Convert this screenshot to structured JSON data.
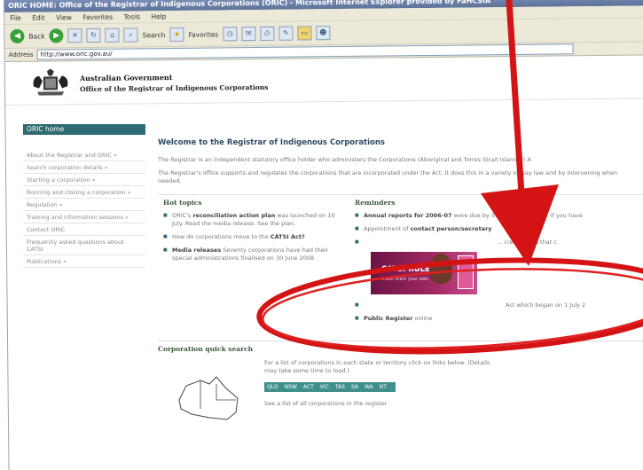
{
  "window": {
    "title": "ORIC HOME: Office of the Registrar of Indigenous Corporations (ORIC) - Microsoft Internet Explorer provided by FaHCSIA"
  },
  "menu": [
    "File",
    "Edit",
    "View",
    "Favorites",
    "Tools",
    "Help"
  ],
  "toolbar": {
    "back_label": "Back",
    "search_label": "Search",
    "favorites_label": "Favorites"
  },
  "address": {
    "label": "Address",
    "url": "http://www.oric.gov.au/"
  },
  "header": {
    "gov_name": "Australian Government",
    "office_name": "Office of the Registrar of Indigenous Corporations"
  },
  "sidebar": {
    "home": "ORIC home",
    "items": [
      "About the Registrar and ORIC »",
      "Search corporation details »",
      "Starting a corporation »",
      "Running and closing a corporation »",
      "Regulation »",
      "Training and information sessions »",
      "Contact ORIC",
      "Frequently asked questions about CATSI",
      "Publications »"
    ]
  },
  "main": {
    "welcome": "Welcome to the Registrar of Indigenous Corporations",
    "para1": "The Registrar is an independent statutory office holder who administers the Corporations (Aboriginal and Torres Strait Islander) A",
    "para2": "The Registrar's office supports and regulates the corporations that are incorporated under the Act. It does this in a variety of way law and by intervening when needed.",
    "hot_topics": {
      "title": "Hot topics",
      "items": [
        {
          "lead": "ORIC's",
          "bold": "reconciliation action plan",
          "rest": "was launched on 10 July. Read the media release. See the plan."
        },
        {
          "lead": "How do corporations move to the",
          "bold": "CATSI Act?",
          "rest": ""
        },
        {
          "lead": "",
          "bold": "Media releases",
          "rest": "Seventy corporations have had their special administrations finalised on 30 June 2008."
        }
      ]
    },
    "reminders": {
      "title": "Reminders",
      "items": [
        {
          "bold": "Annual reports for 2006-07",
          "rest": "were due by 31 December 2007. If you have"
        },
        {
          "lead": "Appointment of",
          "bold": "contact person/secretary",
          "rest": ""
        },
        {
          "lead": "",
          "bold": "",
          "rest": "... create rules that c"
        },
        {
          "lead": "",
          "bold": "",
          "rest": "Act which began on 1 July 2"
        },
        {
          "lead": "",
          "bold": "Public Register",
          "rest": "online"
        }
      ]
    },
    "banner": {
      "title": "CATSI RULES",
      "subtitle": "make them your own"
    },
    "quick_search": {
      "title": "Corporation quick search",
      "text": "For a list of corporations in each state or territory click on links below. (Details may take some time to load.)",
      "states": [
        "QLD",
        "NSW",
        "ACT",
        "VIC",
        "TAS",
        "SA",
        "WA",
        "NT"
      ],
      "all": "See a list of all corporations in the register"
    }
  }
}
